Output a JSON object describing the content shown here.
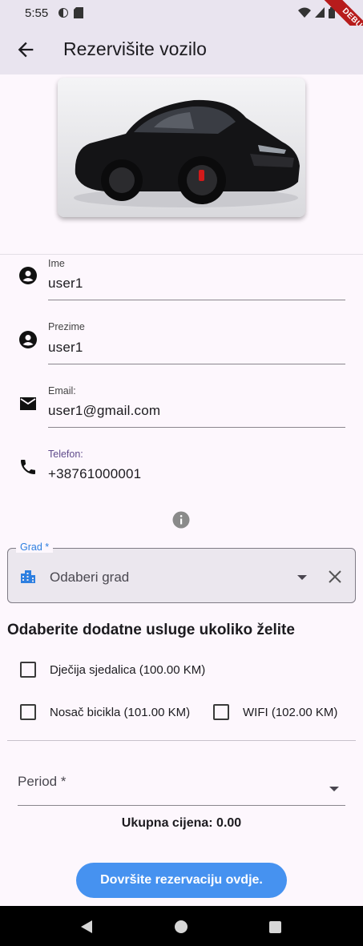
{
  "status_bar": {
    "time": "5:55",
    "debug_label": "DEBUG"
  },
  "app_bar": {
    "title": "Rezervišite vozilo"
  },
  "form": {
    "fields": [
      {
        "label": "Ime",
        "value": "user1"
      },
      {
        "label": "Prezime",
        "value": "user1"
      },
      {
        "label": "Email:",
        "value": "user1@gmail.com"
      },
      {
        "label": "Telefon:",
        "value": "+38761000001"
      }
    ],
    "city": {
      "label": "Grad *",
      "placeholder": "Odaberi grad"
    }
  },
  "services": {
    "heading": "Odaberite dodatne usluge ukoliko želite",
    "options": [
      {
        "label": "Dječija sjedalica (100.00 KM)",
        "checked": false
      },
      {
        "label": "Nosač bicikla (101.00 KM)",
        "checked": false
      },
      {
        "label": "WIFI (102.00 KM)",
        "checked": false
      }
    ]
  },
  "period": {
    "label": "Period *"
  },
  "total": {
    "text": "Ukupna cijena: 0.00"
  },
  "submit": {
    "label": "Dovršite rezervaciju ovdje."
  },
  "colors": {
    "accent": "#4692f0",
    "app_bar": "#e9e4ef",
    "background": "#fdf7fd",
    "label_accent": "#2d7fe0"
  }
}
